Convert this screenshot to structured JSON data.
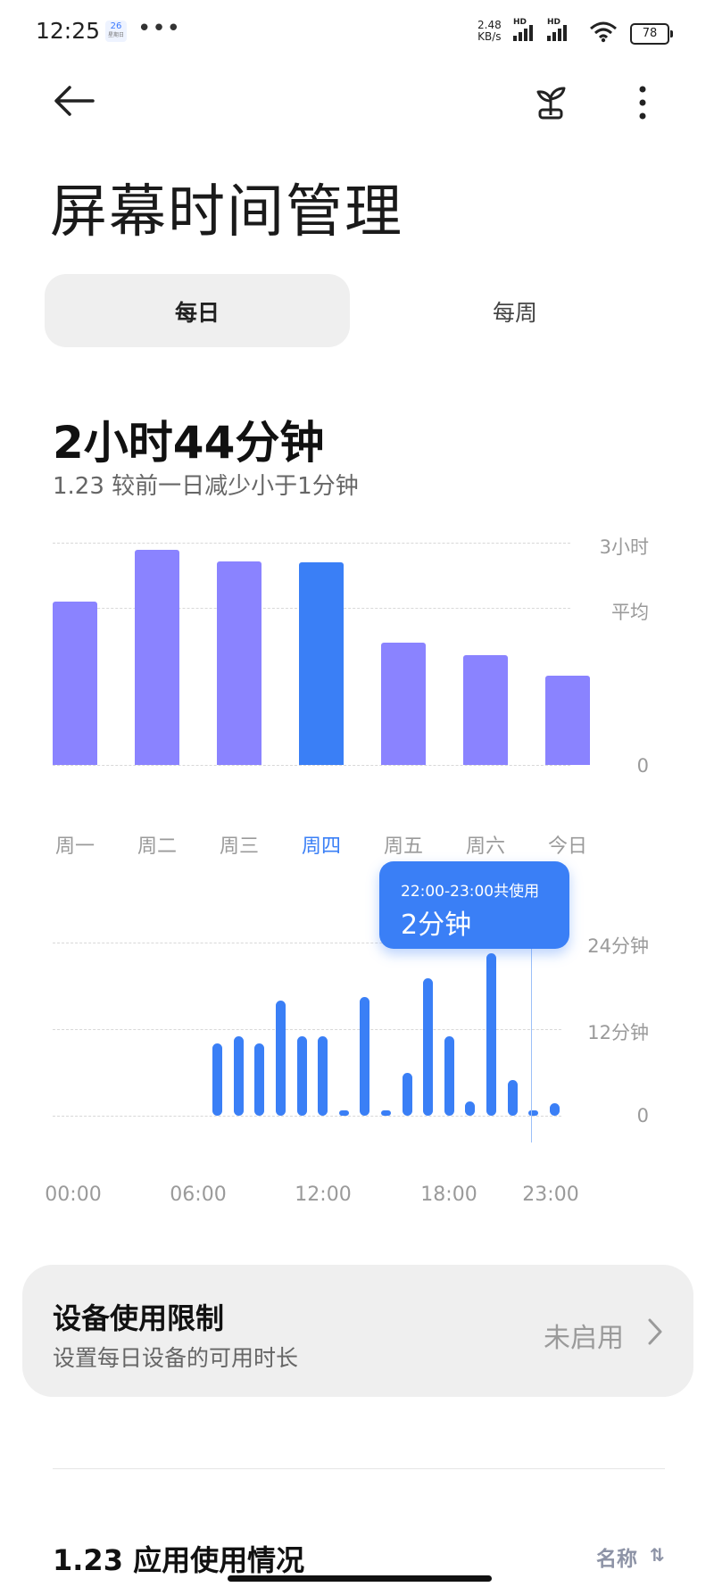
{
  "status_bar": {
    "time": "12:25",
    "calendar_day": "26",
    "calendar_sub": "星期日",
    "more_dots": "•••",
    "net_speed_value": "2.48",
    "net_speed_unit": "KB/s",
    "hd_label": "HD",
    "battery": "78"
  },
  "header": {
    "title": "屏幕时间管理",
    "icons": [
      "back-arrow",
      "sprout",
      "more-vertical"
    ]
  },
  "tabs": {
    "daily": "每日",
    "weekly": "每周",
    "selected": "daily"
  },
  "summary": {
    "total": "2小时44分钟",
    "comparison": "1.23 较前一日减少小于1分钟"
  },
  "weekly_chart": {
    "type": "bar",
    "categories": [
      "周一",
      "周二",
      "周三",
      "周四",
      "周五",
      "周六",
      "今日"
    ],
    "values_hours": [
      2.2,
      2.9,
      2.75,
      2.73,
      1.65,
      1.48,
      1.2
    ],
    "selected_index": 3,
    "y_labels": {
      "max": "3小时",
      "average": "平均",
      "zero": "0"
    },
    "ylim": [
      0,
      3
    ],
    "average_hours": 2.12,
    "colors": {
      "bar": "#8a83ff",
      "selected": "#3a7ff6"
    }
  },
  "chart_data": {
    "type": "bar",
    "categories": [
      "周一",
      "周二",
      "周三",
      "周四",
      "周五",
      "周六",
      "今日"
    ],
    "values": [
      2.2,
      2.9,
      2.75,
      2.73,
      1.65,
      1.48,
      1.2
    ],
    "ylabel": "",
    "ylim": [
      0,
      3
    ]
  },
  "hourly_chart": {
    "type": "bar",
    "x_labels": [
      "00:00",
      "06:00",
      "12:00",
      "18:00",
      "23:00"
    ],
    "values_minutes": [
      0,
      0,
      0,
      0,
      0,
      0,
      0,
      10,
      11,
      10,
      16,
      11,
      11,
      0.5,
      16.5,
      0.5,
      6,
      19,
      11,
      2,
      22.5,
      5,
      0.3,
      1.7
    ],
    "y_labels": {
      "max": "24分钟",
      "mid": "12分钟",
      "zero": "0"
    },
    "ylim": [
      0,
      24
    ],
    "tooltip_line1": "22:00-23:00共使用",
    "tooltip_line2": "2分钟",
    "color": "#3a7ff6"
  },
  "limit_card": {
    "title": "设备使用限制",
    "subtitle": "设置每日设备的可用时长",
    "status": "未启用"
  },
  "app_usage": {
    "title": "1.23 应用使用情况",
    "sort_label": "名称",
    "sort_icon": "⇅"
  }
}
